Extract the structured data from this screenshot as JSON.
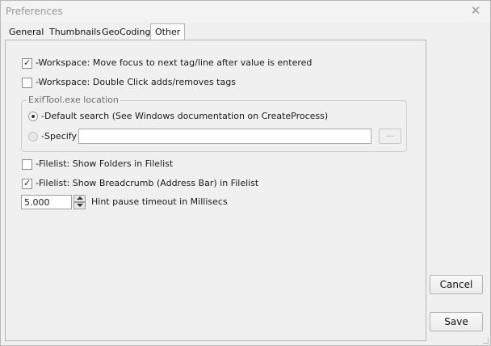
{
  "window": {
    "title": "Preferences",
    "close_glyph": "✕"
  },
  "tabs": [
    {
      "label": "General",
      "active": false
    },
    {
      "label": "Thumbnails",
      "active": false
    },
    {
      "label": "GeoCoding",
      "active": false
    },
    {
      "label": "Other",
      "active": true
    }
  ],
  "options": {
    "workspace_focus": {
      "label": "-Workspace: Move focus to next tag/line after value is entered",
      "checked": true
    },
    "workspace_dblclick": {
      "label": "-Workspace: Double Click adds/removes tags",
      "checked": false
    },
    "filelist_folders": {
      "label": "-Filelist: Show Folders in Filelist",
      "checked": false
    },
    "filelist_breadcrumb": {
      "label": "-Filelist: Show Breadcrumb (Address Bar) in Filelist",
      "checked": true
    }
  },
  "exiftool": {
    "group_label": "ExifTool.exe location",
    "default_label": "-Default search (See Windows documentation on CreateProcess)",
    "default_selected": true,
    "specify_label": "-Specify",
    "specify_value": "",
    "browse_label": "..."
  },
  "hint": {
    "value": "5.000",
    "label": "Hint pause timeout in Millisecs"
  },
  "buttons": {
    "cancel": "Cancel",
    "save": "Save"
  },
  "icons": {
    "check": "check-icon",
    "close": "close-icon",
    "spin_up": "arrow-up-icon",
    "spin_down": "arrow-down-icon"
  }
}
